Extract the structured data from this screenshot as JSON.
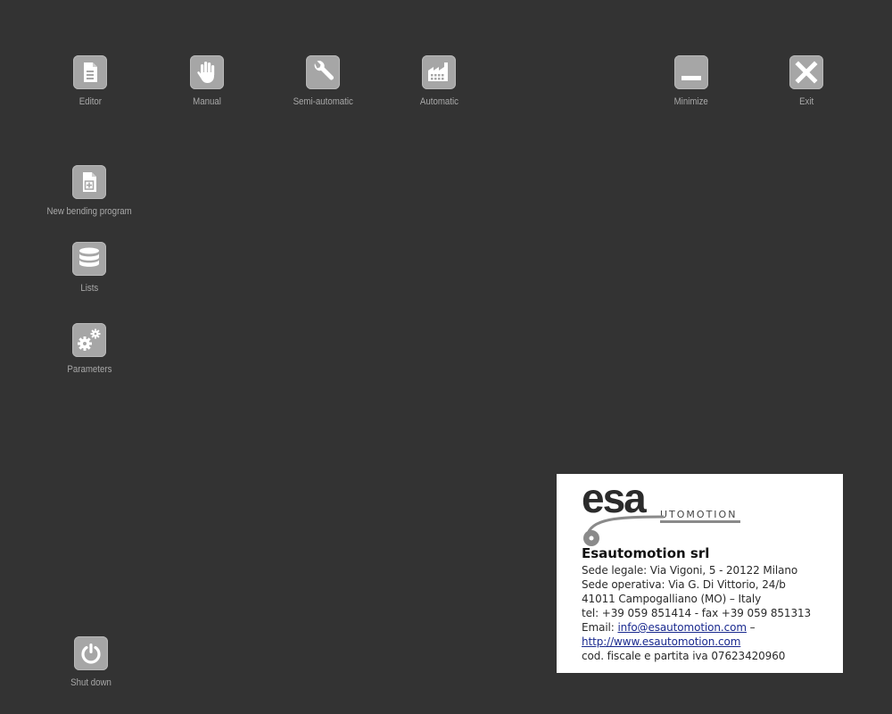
{
  "toolbar": {
    "editor": "Editor",
    "manual": "Manual",
    "semi_automatic": "Semi-automatic",
    "automatic": "Automatic",
    "minimize": "Minimize",
    "exit": "Exit"
  },
  "side_menu": {
    "new_program": "New bending program",
    "lists": "Lists",
    "parameters": "Parameters",
    "shutdown": "Shut down"
  },
  "company_card": {
    "logo_text": "esa",
    "logo_subtext": "UTOMOTION",
    "name": "Esautomotion srl",
    "line1": "Sede legale: Via Vigoni, 5 - 20122 Milano",
    "line2": "Sede operativa: Via G. Di Vittorio, 24/b",
    "line3": "41011 Campogalliano (MO) –  Italy",
    "line4": " tel: +39 059 851414 - fax +39 059 851313",
    "email_prefix": "Email: ",
    "email": "info@esautomotion.com",
    "email_suffix": " –",
    "website": "http://www.esautomotion.com",
    "line7": "cod. fiscale e partita iva 07623420960"
  },
  "colors": {
    "background": "#333333",
    "button": "#a6a6a6",
    "label": "#a8a8a8",
    "link": "#1a2a8f"
  }
}
